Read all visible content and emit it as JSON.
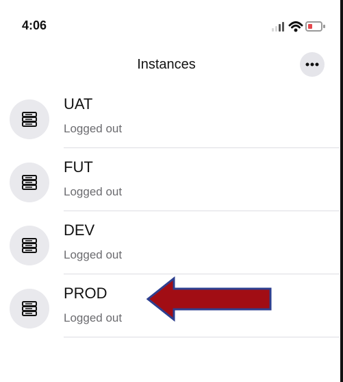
{
  "status_bar": {
    "time": "4:06",
    "icons": [
      "signal-icon",
      "wifi-icon",
      "battery-low-icon"
    ]
  },
  "nav": {
    "title": "Instances",
    "more_icon": "more-icon"
  },
  "instances": [
    {
      "name": "UAT",
      "status": "Logged out",
      "icon": "server-icon"
    },
    {
      "name": "FUT",
      "status": "Logged out",
      "icon": "server-icon"
    },
    {
      "name": "DEV",
      "status": "Logged out",
      "icon": "server-icon"
    },
    {
      "name": "PROD",
      "status": "Logged out",
      "icon": "server-icon"
    }
  ],
  "colors": {
    "arrow_fill": "#a10d14",
    "arrow_stroke": "#2d3f8f",
    "battery_low": "#e5484d",
    "avatar_bg": "#e9e9ed",
    "subtitle": "#6b6b6f"
  }
}
